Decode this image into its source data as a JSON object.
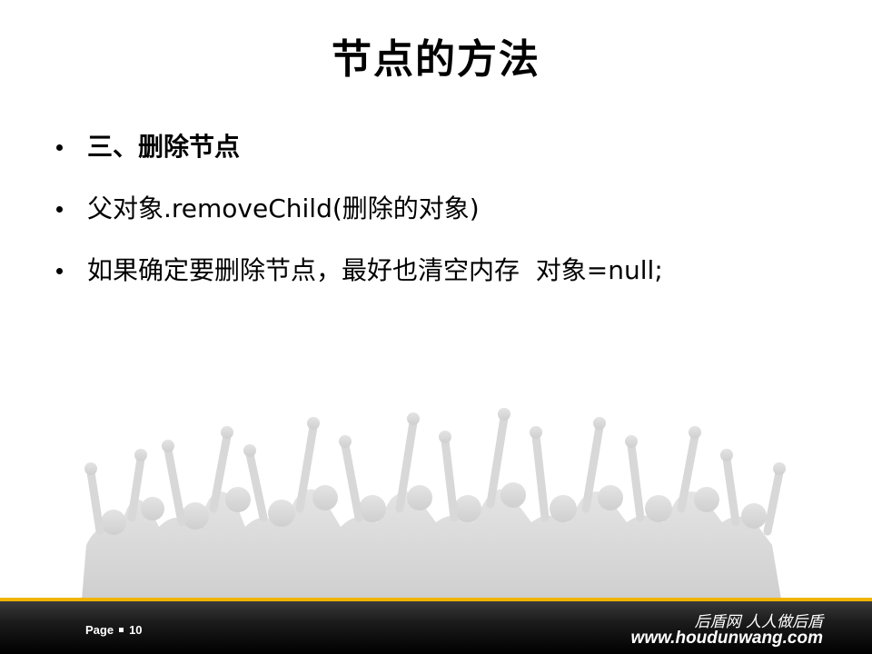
{
  "slide": {
    "title": "节点的方法",
    "bullets": [
      {
        "text": "三、删除节点",
        "bold": true
      },
      {
        "text": "父对象.removeChild(删除的对象)",
        "bold": false
      },
      {
        "text": "如果确定要删除节点，最好也清空内存  对象=null;",
        "bold": false
      }
    ]
  },
  "footer": {
    "page_label": "Page",
    "page_number": "10",
    "slogan": "后盾网 人人做后盾",
    "url": "www.houdunwang.com",
    "accent_color": "#f0b400"
  },
  "decor": {
    "crowd_color": "#d6d6d6",
    "bullet_icon": "bullet-dot-icon"
  }
}
